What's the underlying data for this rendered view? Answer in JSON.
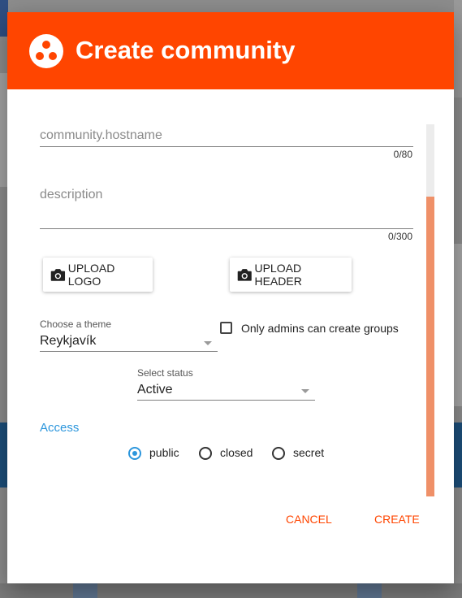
{
  "dialog": {
    "title": "Create community",
    "logo_icon": "community-dots-icon",
    "accent_color": "#ff4500"
  },
  "form": {
    "hostname": {
      "placeholder": "community.hostname",
      "value": "",
      "counter": "0/80"
    },
    "description": {
      "placeholder": "description",
      "value": "",
      "counter": "0/300"
    },
    "upload_logo_label": "UPLOAD LOGO",
    "upload_header_label": "UPLOAD HEADER",
    "camera_icon": "camera-icon",
    "theme": {
      "label": "Choose a theme",
      "value": "Reykjavík"
    },
    "admins_only": {
      "label": "Only admins can create groups",
      "checked": false
    },
    "status": {
      "label": "Select status",
      "value": "Active"
    },
    "access": {
      "label": "Access",
      "options": [
        {
          "label": "public",
          "checked": true
        },
        {
          "label": "closed",
          "checked": false
        },
        {
          "label": "secret",
          "checked": false
        }
      ]
    }
  },
  "actions": {
    "cancel_label": "CANCEL",
    "create_label": "CREATE"
  },
  "colors": {
    "header": "#ff4500",
    "access_label": "#2c96dc",
    "scroll_thumb": "#ef9068"
  }
}
